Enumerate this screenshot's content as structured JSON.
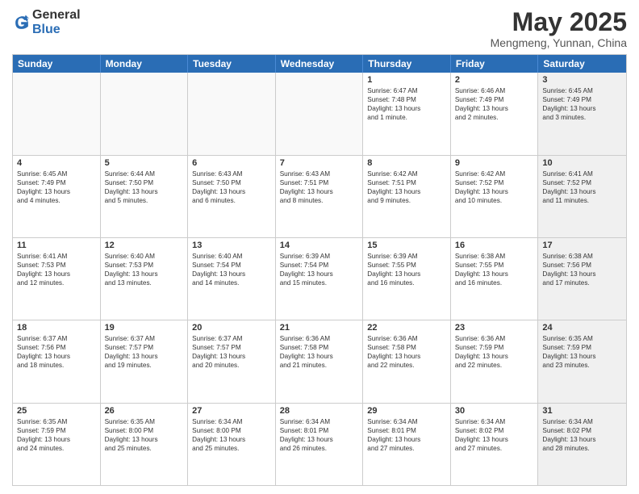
{
  "logo": {
    "general": "General",
    "blue": "Blue"
  },
  "title": {
    "month": "May 2025",
    "location": "Mengmeng, Yunnan, China"
  },
  "header_days": [
    "Sunday",
    "Monday",
    "Tuesday",
    "Wednesday",
    "Thursday",
    "Friday",
    "Saturday"
  ],
  "weeks": [
    [
      {
        "day": "",
        "shaded": true,
        "text": ""
      },
      {
        "day": "",
        "shaded": true,
        "text": ""
      },
      {
        "day": "",
        "shaded": true,
        "text": ""
      },
      {
        "day": "",
        "shaded": true,
        "text": ""
      },
      {
        "day": "1",
        "shaded": false,
        "text": "Sunrise: 6:47 AM\nSunset: 7:48 PM\nDaylight: 13 hours\nand 1 minute."
      },
      {
        "day": "2",
        "shaded": false,
        "text": "Sunrise: 6:46 AM\nSunset: 7:49 PM\nDaylight: 13 hours\nand 2 minutes."
      },
      {
        "day": "3",
        "shaded": true,
        "text": "Sunrise: 6:45 AM\nSunset: 7:49 PM\nDaylight: 13 hours\nand 3 minutes."
      }
    ],
    [
      {
        "day": "4",
        "shaded": false,
        "text": "Sunrise: 6:45 AM\nSunset: 7:49 PM\nDaylight: 13 hours\nand 4 minutes."
      },
      {
        "day": "5",
        "shaded": false,
        "text": "Sunrise: 6:44 AM\nSunset: 7:50 PM\nDaylight: 13 hours\nand 5 minutes."
      },
      {
        "day": "6",
        "shaded": false,
        "text": "Sunrise: 6:43 AM\nSunset: 7:50 PM\nDaylight: 13 hours\nand 6 minutes."
      },
      {
        "day": "7",
        "shaded": false,
        "text": "Sunrise: 6:43 AM\nSunset: 7:51 PM\nDaylight: 13 hours\nand 8 minutes."
      },
      {
        "day": "8",
        "shaded": false,
        "text": "Sunrise: 6:42 AM\nSunset: 7:51 PM\nDaylight: 13 hours\nand 9 minutes."
      },
      {
        "day": "9",
        "shaded": false,
        "text": "Sunrise: 6:42 AM\nSunset: 7:52 PM\nDaylight: 13 hours\nand 10 minutes."
      },
      {
        "day": "10",
        "shaded": true,
        "text": "Sunrise: 6:41 AM\nSunset: 7:52 PM\nDaylight: 13 hours\nand 11 minutes."
      }
    ],
    [
      {
        "day": "11",
        "shaded": false,
        "text": "Sunrise: 6:41 AM\nSunset: 7:53 PM\nDaylight: 13 hours\nand 12 minutes."
      },
      {
        "day": "12",
        "shaded": false,
        "text": "Sunrise: 6:40 AM\nSunset: 7:53 PM\nDaylight: 13 hours\nand 13 minutes."
      },
      {
        "day": "13",
        "shaded": false,
        "text": "Sunrise: 6:40 AM\nSunset: 7:54 PM\nDaylight: 13 hours\nand 14 minutes."
      },
      {
        "day": "14",
        "shaded": false,
        "text": "Sunrise: 6:39 AM\nSunset: 7:54 PM\nDaylight: 13 hours\nand 15 minutes."
      },
      {
        "day": "15",
        "shaded": false,
        "text": "Sunrise: 6:39 AM\nSunset: 7:55 PM\nDaylight: 13 hours\nand 16 minutes."
      },
      {
        "day": "16",
        "shaded": false,
        "text": "Sunrise: 6:38 AM\nSunset: 7:55 PM\nDaylight: 13 hours\nand 16 minutes."
      },
      {
        "day": "17",
        "shaded": true,
        "text": "Sunrise: 6:38 AM\nSunset: 7:56 PM\nDaylight: 13 hours\nand 17 minutes."
      }
    ],
    [
      {
        "day": "18",
        "shaded": false,
        "text": "Sunrise: 6:37 AM\nSunset: 7:56 PM\nDaylight: 13 hours\nand 18 minutes."
      },
      {
        "day": "19",
        "shaded": false,
        "text": "Sunrise: 6:37 AM\nSunset: 7:57 PM\nDaylight: 13 hours\nand 19 minutes."
      },
      {
        "day": "20",
        "shaded": false,
        "text": "Sunrise: 6:37 AM\nSunset: 7:57 PM\nDaylight: 13 hours\nand 20 minutes."
      },
      {
        "day": "21",
        "shaded": false,
        "text": "Sunrise: 6:36 AM\nSunset: 7:58 PM\nDaylight: 13 hours\nand 21 minutes."
      },
      {
        "day": "22",
        "shaded": false,
        "text": "Sunrise: 6:36 AM\nSunset: 7:58 PM\nDaylight: 13 hours\nand 22 minutes."
      },
      {
        "day": "23",
        "shaded": false,
        "text": "Sunrise: 6:36 AM\nSunset: 7:59 PM\nDaylight: 13 hours\nand 22 minutes."
      },
      {
        "day": "24",
        "shaded": true,
        "text": "Sunrise: 6:35 AM\nSunset: 7:59 PM\nDaylight: 13 hours\nand 23 minutes."
      }
    ],
    [
      {
        "day": "25",
        "shaded": false,
        "text": "Sunrise: 6:35 AM\nSunset: 7:59 PM\nDaylight: 13 hours\nand 24 minutes."
      },
      {
        "day": "26",
        "shaded": false,
        "text": "Sunrise: 6:35 AM\nSunset: 8:00 PM\nDaylight: 13 hours\nand 25 minutes."
      },
      {
        "day": "27",
        "shaded": false,
        "text": "Sunrise: 6:34 AM\nSunset: 8:00 PM\nDaylight: 13 hours\nand 25 minutes."
      },
      {
        "day": "28",
        "shaded": false,
        "text": "Sunrise: 6:34 AM\nSunset: 8:01 PM\nDaylight: 13 hours\nand 26 minutes."
      },
      {
        "day": "29",
        "shaded": false,
        "text": "Sunrise: 6:34 AM\nSunset: 8:01 PM\nDaylight: 13 hours\nand 27 minutes."
      },
      {
        "day": "30",
        "shaded": false,
        "text": "Sunrise: 6:34 AM\nSunset: 8:02 PM\nDaylight: 13 hours\nand 27 minutes."
      },
      {
        "day": "31",
        "shaded": true,
        "text": "Sunrise: 6:34 AM\nSunset: 8:02 PM\nDaylight: 13 hours\nand 28 minutes."
      }
    ]
  ]
}
